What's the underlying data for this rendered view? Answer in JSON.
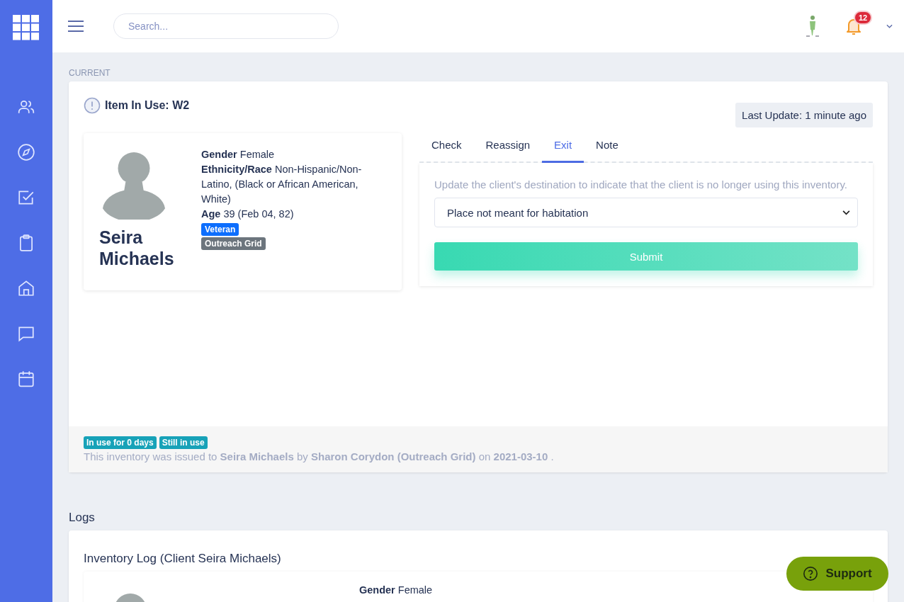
{
  "search": {
    "placeholder": "Search..."
  },
  "notifications": {
    "count": "12"
  },
  "current": {
    "section_label": "CURRENT",
    "title": "Item In Use: W2",
    "last_update": "Last Update: 1 minute ago",
    "client": {
      "name": "Seira Michaels",
      "details": [
        "**Gender** Female",
        "**Ethnicity/Race** Non-Hispanic/Non-Latino, (Black or African American, White)",
        "**Age** 39 (Feb 04, 82)"
      ],
      "tags": [
        {
          "label": "Veteran",
          "color": "#0d6efd"
        },
        {
          "label": "Outreach Grid",
          "color": "#6c757d"
        }
      ]
    },
    "tabs": [
      {
        "label": "Check",
        "selected": false
      },
      {
        "label": "Reassign",
        "selected": false
      },
      {
        "label": "Exit",
        "selected": true
      },
      {
        "label": "Note",
        "selected": false
      }
    ],
    "exit_form": {
      "instructions": "Update the client's destination to indicate that the client is no longer using this inventory.",
      "destination": "Place not meant for habitation",
      "submit": "Submit"
    },
    "status_badges": [
      "In use for 0 days",
      "Still in use"
    ],
    "issued_note": "This inventory was issued to **Seira Michaels** by **Sharon Corydon (Outreach Grid)** on **2021-03-10** ."
  },
  "logs": {
    "heading": "Logs",
    "log_title": "Inventory Log (Client Seira Michaels)",
    "details": [
      "**Gender** Female"
    ]
  },
  "support_button": "Support"
}
